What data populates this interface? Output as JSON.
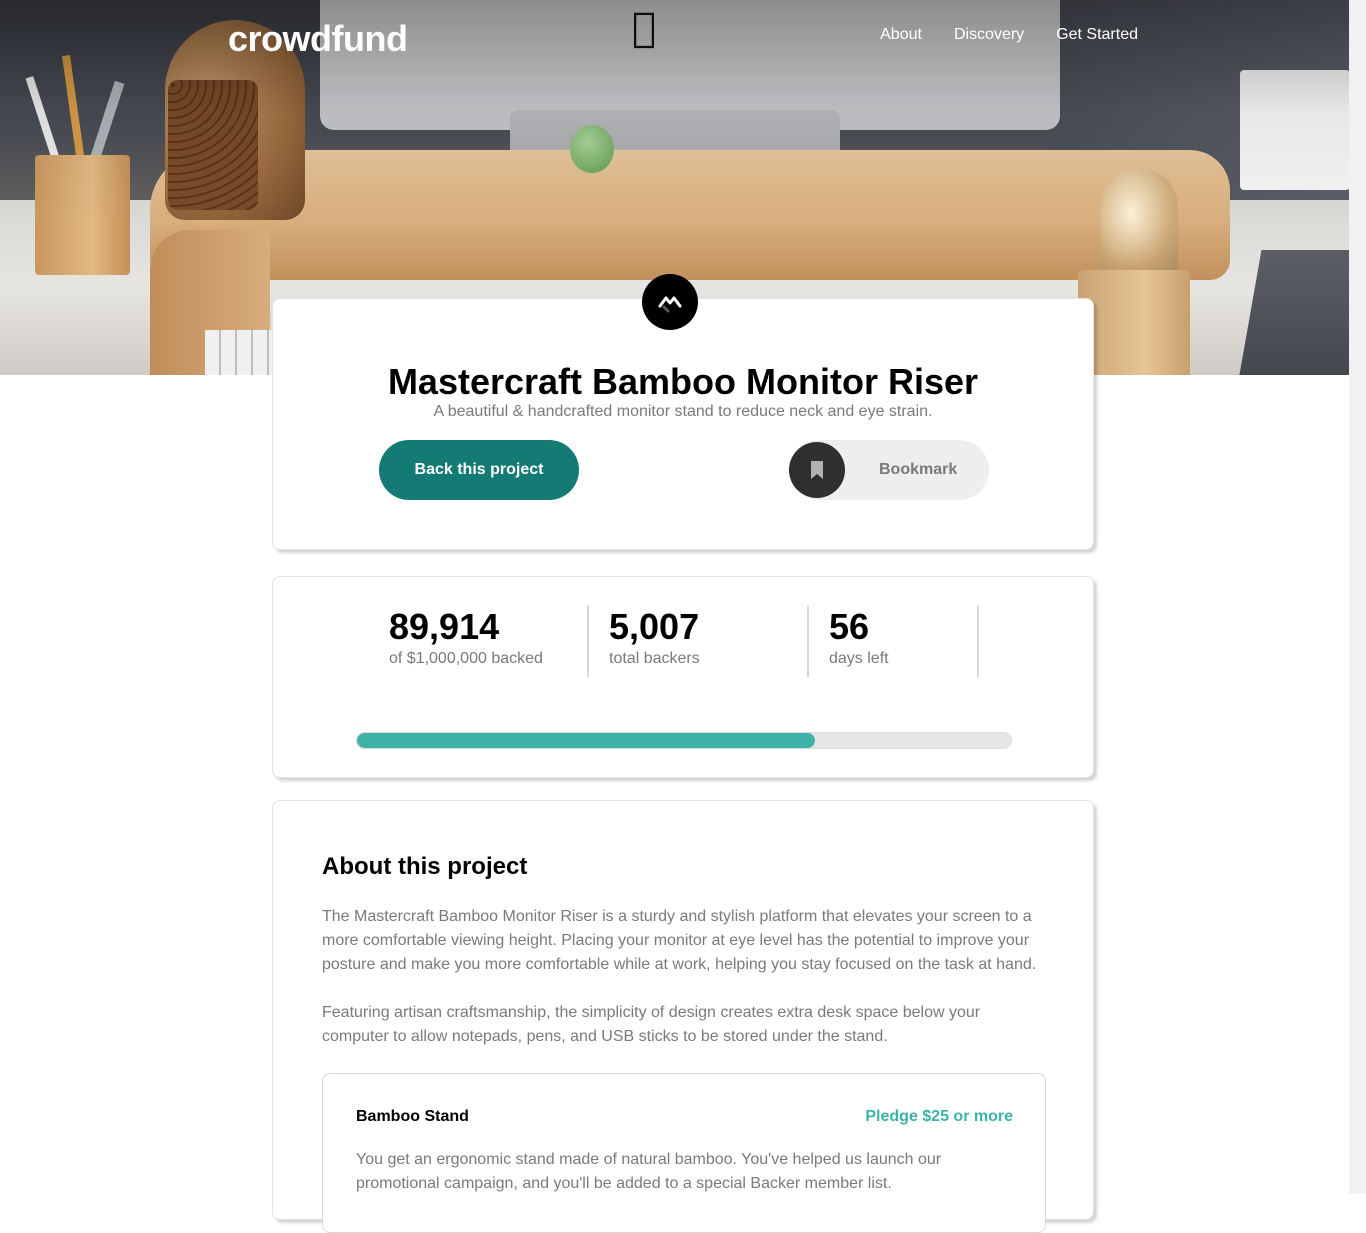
{
  "brand": {
    "logo_text": "crowdfund"
  },
  "nav": {
    "items": [
      {
        "label": "About"
      },
      {
        "label": "Discovery"
      },
      {
        "label": "Get Started"
      }
    ]
  },
  "project": {
    "title": "Mastercraft Bamboo Monitor Riser",
    "subtitle": "A beautiful & handcrafted monitor stand to reduce neck and eye strain.",
    "back_button_label": "Back this project",
    "bookmark_label": "Bookmark"
  },
  "stats": {
    "items": [
      {
        "value": "89,914",
        "label": "of $1,000,000 backed"
      },
      {
        "value": "5,007",
        "label": "total backers"
      },
      {
        "value": "56",
        "label": "days left"
      }
    ],
    "progress_fraction": 0.7
  },
  "about": {
    "title": "About this project",
    "paragraphs": [
      "The Mastercraft Bamboo Monitor Riser is a sturdy and stylish platform that elevates your screen to a more comfortable viewing height. Placing your monitor at eye level has the potential to improve your posture and make you more comfortable while at work, helping you stay focused on the task at hand.",
      "Featuring artisan craftsmanship, the simplicity of design creates extra desk space below your computer to allow notepads, pens, and USB sticks to be stored under the stand."
    ],
    "pledges": [
      {
        "name": "Bamboo Stand",
        "minimum": "Pledge $25 or more",
        "description": "You get an ergonomic stand made of natural bamboo. You've helped us launch our promotional campaign, and you'll be added to a special Backer member list."
      }
    ]
  },
  "colors": {
    "primary": "#147b74",
    "accent": "#3cb3a6",
    "text_muted": "#7a7a7a",
    "dark": "#2f2f2f"
  },
  "icons": {
    "project_logo": "mastercraft-logo-icon",
    "bookmark": "bookmark-icon"
  }
}
